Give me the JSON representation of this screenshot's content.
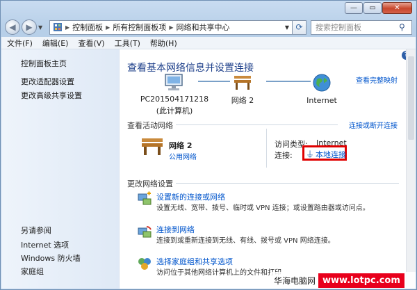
{
  "window": {
    "controls": [
      "minimize",
      "maximize",
      "close"
    ]
  },
  "navigation": {
    "back_icon": "back-arrow-icon",
    "forward_icon": "forward-arrow-icon",
    "breadcrumbs": [
      "控制面板",
      "所有控制面板项",
      "网络和共享中心"
    ],
    "search_placeholder": "搜索控制面板"
  },
  "menu": {
    "items": [
      "文件(F)",
      "编辑(E)",
      "查看(V)",
      "工具(T)",
      "帮助(H)"
    ]
  },
  "sidebar": {
    "home": "控制面板主页",
    "links": [
      "更改适配器设置",
      "更改高级共享设置"
    ],
    "see_also_title": "另请参阅",
    "see_also": [
      "Internet 选项",
      "Windows 防火墙",
      "家庭组"
    ]
  },
  "main": {
    "title": "查看基本网络信息并设置连接",
    "full_map_link": "查看完整映射",
    "map": {
      "computer_name": "PC201504171218",
      "computer_sub": "(此计算机)",
      "network": "网络  2",
      "internet": "Internet"
    },
    "active_section": "查看活动网络",
    "connect_disconnect": "连接或断开连接",
    "active_network": {
      "name": "网络  2",
      "type": "公用网络",
      "access_label": "访问类型:",
      "access_value": "Internet",
      "connections_label": "连接:",
      "connection_value": "本地连接"
    },
    "change_section": "更改网络设置",
    "tasks": [
      {
        "title": "设置新的连接或网络",
        "desc": "设置无线、宽带、拨号、临时或 VPN 连接；或设置路由器或访问点。"
      },
      {
        "title": "连接到网络",
        "desc": "连接到或重新连接到无线、有线、拨号或 VPN 网络连接。"
      },
      {
        "title": "选择家庭组和共享选项",
        "desc": "访问位于其他网络计算机上的文件和打印"
      }
    ]
  },
  "watermark": {
    "text": "华海电脑网",
    "badge": "www.lotpc.com"
  },
  "colors": {
    "link": "#0055cc",
    "title": "#1d3f8a",
    "highlight": "#e00000"
  }
}
